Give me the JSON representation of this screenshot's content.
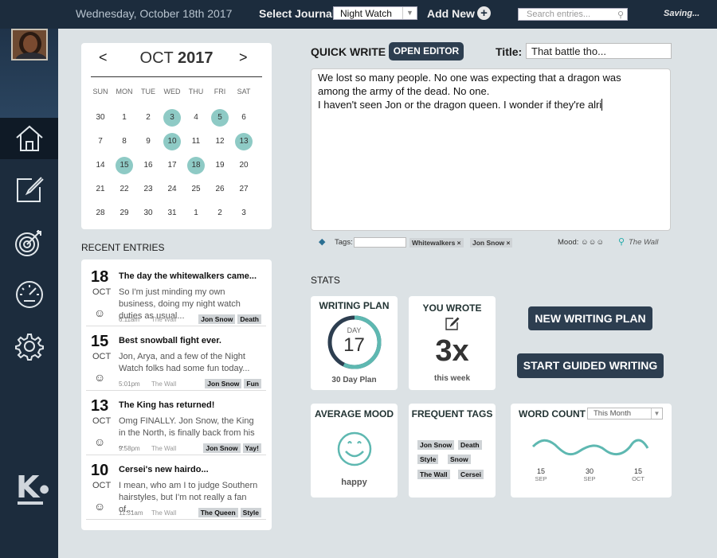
{
  "topbar": {
    "date": "Wednesday, October 18th 2017",
    "select_journal_label": "Select Journal",
    "journal_value": "Night Watch",
    "add_new_label": "Add New",
    "search_placeholder": "Search entries...",
    "status": "Saving..."
  },
  "sidebar": {
    "items": [
      {
        "name": "home",
        "active": true
      },
      {
        "name": "write"
      },
      {
        "name": "goals"
      },
      {
        "name": "dashboard"
      },
      {
        "name": "settings"
      }
    ],
    "logo": "K"
  },
  "calendar": {
    "month": "OCT",
    "year": "2017",
    "weekdays": [
      "SUN",
      "MON",
      "TUE",
      "WED",
      "THU",
      "FRI",
      "SAT"
    ],
    "weeks": [
      [
        "30",
        "1",
        "2",
        "3",
        "4",
        "5",
        "6"
      ],
      [
        "7",
        "8",
        "9",
        "10",
        "11",
        "12",
        "13"
      ],
      [
        "14",
        "15",
        "16",
        "17",
        "18",
        "19",
        "20"
      ],
      [
        "21",
        "22",
        "23",
        "24",
        "25",
        "26",
        "27"
      ],
      [
        "28",
        "29",
        "30",
        "31",
        "1",
        "2",
        "3"
      ]
    ],
    "marked": [
      "0-3",
      "0-5",
      "1-3",
      "1-6",
      "2-1",
      "2-4"
    ]
  },
  "recent": {
    "label": "RECENT ENTRIES",
    "entries": [
      {
        "day": "18",
        "month": "OCT",
        "mood": "☺",
        "title": "The day the whitewalkers came...",
        "body": "So I'm just minding my own business, doing my night watch duties as usual...",
        "time": "6:11am",
        "location": "The Wall",
        "tags": [
          "Jon Snow",
          "Death"
        ]
      },
      {
        "day": "15",
        "month": "OCT",
        "mood": "☺",
        "title": "Best snowball fight ever.",
        "body": "Jon, Arya, and a few of the Night Watch folks had some fun today...",
        "time": "5:01pm",
        "location": "The Wall",
        "tags": [
          "Jon Snow",
          "Fun"
        ]
      },
      {
        "day": "13",
        "month": "OCT",
        "mood": "☺",
        "title": "The King has returned!",
        "body": "Omg FINALLY. Jon Snow, the King in the North, is finally back from his ...",
        "time": "9:58pm",
        "location": "The Wall",
        "tags": [
          "Jon Snow",
          "Yay!"
        ]
      },
      {
        "day": "10",
        "month": "OCT",
        "mood": "☺",
        "title": "Cersei's new hairdo...",
        "body": "I mean, who am I to judge Southern hairstyles, but I'm not really a fan of...",
        "time": "11:51am",
        "location": "The Wall",
        "tags": [
          "The Queen",
          "Style"
        ]
      }
    ]
  },
  "quick_write": {
    "label": "QUICK WRITE",
    "open_editor": "OPEN EDITOR",
    "title_label": "Title:",
    "title_value": "That battle tho...",
    "body_lines": [
      "We lost so many people. No one was expecting that a dragon was",
      "among the army of the dead. No one.",
      "I haven't seen Jon or the dragon queen. I wonder if they're alri"
    ],
    "tags_label": "Tags:",
    "tags": [
      "Whitewalkers ×",
      "Jon Snow ×"
    ],
    "mood_label": "Mood:",
    "mood_faces": "☺☺☺",
    "location": "The Wall"
  },
  "stats": {
    "label": "STATS",
    "writing_plan": {
      "title": "WRITING PLAN",
      "day_label": "DAY",
      "day": "17",
      "plan": "30 Day Plan",
      "progress": 0.57
    },
    "you_wrote": {
      "title": "YOU WROTE",
      "value": "3x",
      "period": "this week"
    },
    "new_plan_button": "NEW WRITING PLAN",
    "guided_button": "START GUIDED WRITING",
    "average_mood": {
      "title": "AVERAGE MOOD",
      "value": "happy"
    },
    "frequent_tags": {
      "title": "FREQUENT TAGS",
      "tags": [
        "Jon Snow",
        "Death",
        "Style",
        "Snow",
        "The Wall",
        "Cersei"
      ]
    },
    "word_count": {
      "title": "WORD COUNT",
      "range": "This Month",
      "ticks": [
        {
          "d": "15",
          "m": "SEP"
        },
        {
          "d": "30",
          "m": "SEP"
        },
        {
          "d": "15",
          "m": "OCT"
        }
      ]
    }
  },
  "colors": {
    "accent": "#2d3e50",
    "teal": "#5eb8b1",
    "sidebar": "#1c2c3d"
  }
}
